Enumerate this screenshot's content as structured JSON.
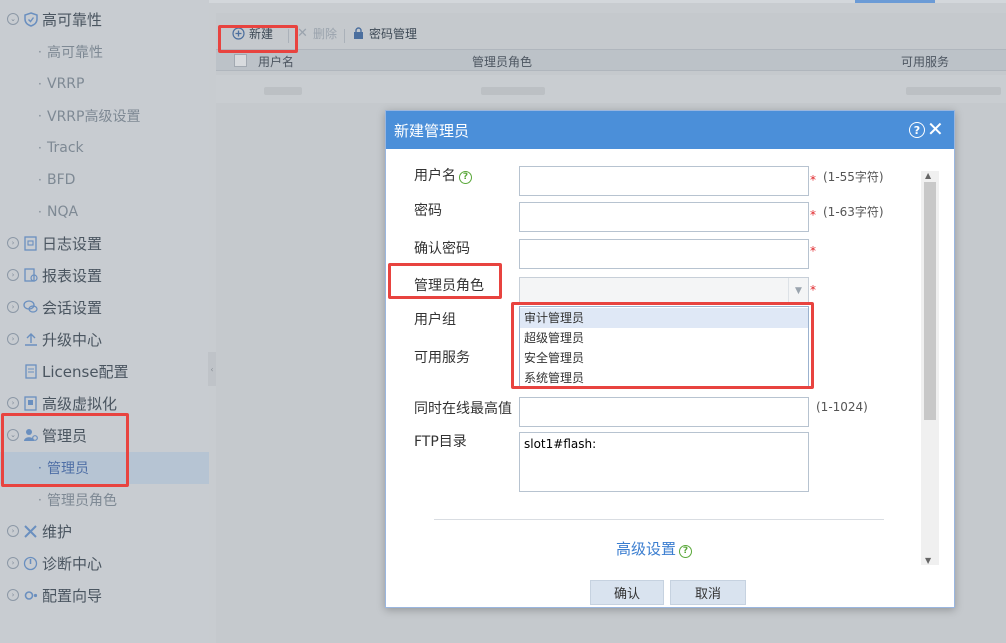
{
  "sidebar": {
    "items": [
      {
        "label": "高可靠性",
        "icon": "shield-icon"
      },
      {
        "label": "日志设置",
        "icon": "log-icon"
      },
      {
        "label": "报表设置",
        "icon": "report-icon"
      },
      {
        "label": "会话设置",
        "icon": "session-icon"
      },
      {
        "label": "升级中心",
        "icon": "upgrade-icon"
      },
      {
        "label": "License配置",
        "icon": "license-icon"
      },
      {
        "label": "高级虚拟化",
        "icon": "virtualization-icon"
      },
      {
        "label": "管理员",
        "icon": "admin-icon"
      },
      {
        "label": "维护",
        "icon": "maintenance-icon"
      },
      {
        "label": "诊断中心",
        "icon": "diagnosis-icon"
      },
      {
        "label": "配置向导",
        "icon": "wizard-icon"
      }
    ],
    "ha_subitems": [
      "高可靠性",
      "VRRP",
      "VRRP高级设置",
      "Track",
      "BFD",
      "NQA"
    ],
    "admin_subitems": [
      "管理员",
      "管理员角色"
    ]
  },
  "toolbar": {
    "new_label": "新建",
    "delete_label": "删除",
    "password_label": "密码管理"
  },
  "grid": {
    "columns": [
      "用户名",
      "管理员角色",
      "可用服务"
    ]
  },
  "dialog": {
    "title": "新建管理员",
    "fields": {
      "username": {
        "label": "用户名",
        "hint": "(1-55字符)",
        "value": ""
      },
      "password": {
        "label": "密码",
        "hint": "(1-63字符)",
        "value": ""
      },
      "confirm_password": {
        "label": "确认密码",
        "value": ""
      },
      "role": {
        "label": "管理员角色",
        "value": ""
      },
      "user_group": {
        "label": "用户组"
      },
      "services": {
        "label": "可用服务"
      },
      "max_online": {
        "label": "同时在线最高值",
        "hint": "(1-1024)",
        "value": ""
      },
      "ftp_dir": {
        "label": "FTP目录",
        "value": "slot1#flash:"
      }
    },
    "role_options": [
      "审计管理员",
      "超级管理员",
      "安全管理员",
      "系统管理员"
    ],
    "advanced_label": "高级设置",
    "confirm_label": "确认",
    "cancel_label": "取消"
  },
  "colors": {
    "accent": "#4b8fd9",
    "highlight": "#e8433f"
  }
}
